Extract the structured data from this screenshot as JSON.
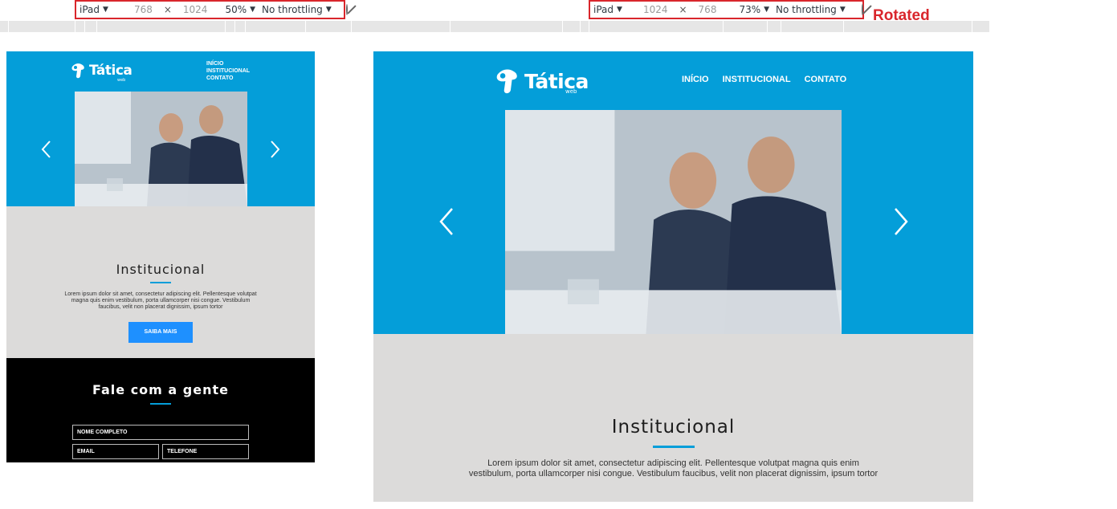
{
  "devtools": {
    "left": {
      "device": "iPad",
      "width": "768",
      "height": "1024",
      "zoom": "50%",
      "throttling": "No throttling"
    },
    "right": {
      "device": "iPad",
      "width": "1024",
      "height": "768",
      "zoom": "73%",
      "throttling": "No throttling"
    },
    "separator": "×",
    "rotated_label": "Rotated"
  },
  "site": {
    "logo_text": "Tática",
    "logo_sub": "web",
    "nav": [
      "INÍCIO",
      "INSTITUCIONAL",
      "CONTATO"
    ],
    "section_title": "Institucional",
    "lorem": "Lorem ipsum dolor sit amet, consectetur adipiscing elit. Pellentesque volutpat magna quis enim vestibulum, porta ullamcorper nisi congue. Vestibulum faucibus, velit non placerat dignissim, ipsum tortor",
    "cta_label": "SAIBA MAIS",
    "contact_title": "Fale com a gente",
    "fields": {
      "name": "NOME COMPLETO",
      "email": "EMAIL",
      "phone": "TELEFONE"
    }
  },
  "colors": {
    "brand_blue": "#049ed9",
    "cta_blue": "#1e90ff",
    "gray_bg": "#dcdbda",
    "highlight_red": "#d9262c"
  }
}
